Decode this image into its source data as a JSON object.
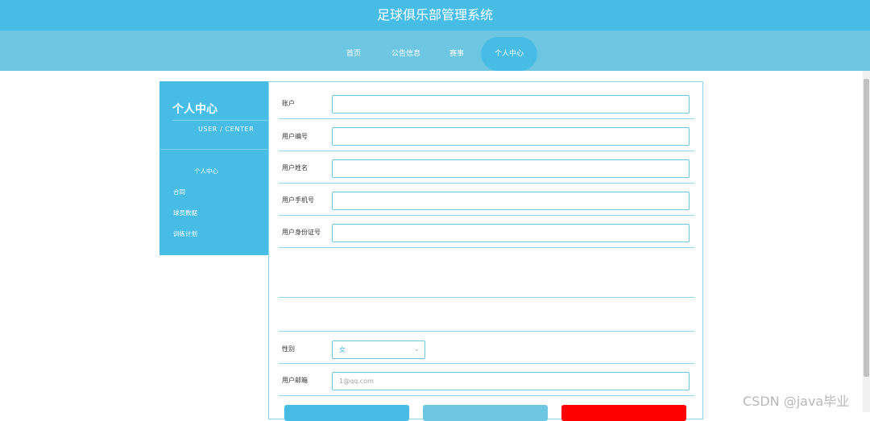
{
  "header": {
    "title": "足球俱乐部管理系统"
  },
  "nav": {
    "items": [
      {
        "label": "首页"
      },
      {
        "label": "公告信息"
      },
      {
        "label": "赛事"
      },
      {
        "label": "个人中心"
      }
    ],
    "active": "个人中心"
  },
  "sidebar": {
    "title": "个人中心",
    "subtitle": "USER / CENTER",
    "items": [
      {
        "label": "个人中心"
      },
      {
        "label": "合同"
      },
      {
        "label": "球员数据"
      },
      {
        "label": "训练计划"
      }
    ]
  },
  "form": {
    "account": {
      "label": "账户",
      "value": ""
    },
    "user_no": {
      "label": "用户编号",
      "value": ""
    },
    "user_name": {
      "label": "用户姓名",
      "value": ""
    },
    "user_phone": {
      "label": "用户手机号",
      "value": ""
    },
    "user_id_card": {
      "label": "用户身份证号",
      "value": ""
    },
    "gender": {
      "label": "性别",
      "value": "女"
    },
    "email": {
      "label": "用户邮箱",
      "value": "1@qq.com"
    }
  },
  "colors": {
    "primary": "#47bde6",
    "nav": "#6ec7e2",
    "danger": "#ff0000"
  },
  "watermark": "CSDN @java毕业"
}
